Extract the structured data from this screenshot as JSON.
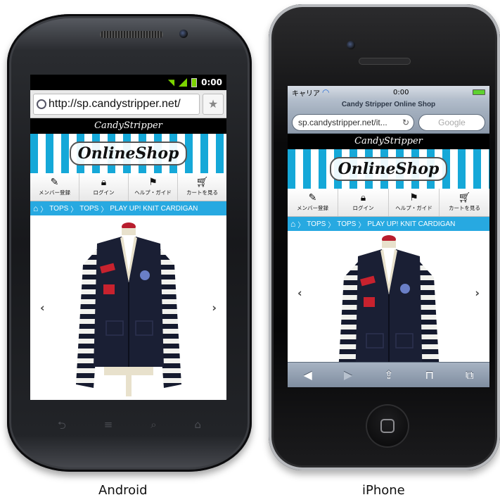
{
  "android": {
    "label": "Android",
    "status_time": "0:00",
    "url": "http://sp.candystripper.net/",
    "softkeys": [
      "⮌",
      "≡",
      "⌕",
      "⌂"
    ]
  },
  "iphone": {
    "label": "iPhone",
    "carrier": "キャリア",
    "status_time": "0:00",
    "page_title": "Candy Stripper Online Shop",
    "url": "sp.candystripper.net/it...",
    "search_placeholder": "Google"
  },
  "site": {
    "logo_text": "CandyStripper",
    "banner_text": "OnlineShop",
    "nav": [
      {
        "label": "メンバー登録",
        "icon": "edit-icon"
      },
      {
        "label": "ログイン",
        "icon": "lock-icon"
      },
      {
        "label": "ヘルプ・ガイド",
        "icon": "signpost-icon"
      },
      {
        "label": "カートを見る",
        "icon": "cart-icon"
      }
    ],
    "breadcrumb": [
      "TOPS",
      "TOPS",
      "PLAY UP! KNIT CARDIGAN"
    ]
  },
  "colors": {
    "accent_blue": "#27a9e1",
    "stripe_blue": "#15a8d8"
  }
}
